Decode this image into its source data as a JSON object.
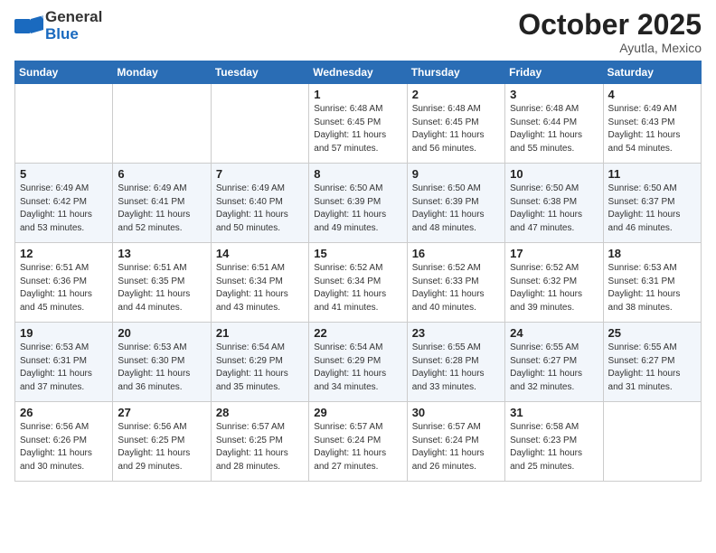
{
  "header": {
    "logo_general": "General",
    "logo_blue": "Blue",
    "month_title": "October 2025",
    "location": "Ayutla, Mexico"
  },
  "days_of_week": [
    "Sunday",
    "Monday",
    "Tuesday",
    "Wednesday",
    "Thursday",
    "Friday",
    "Saturday"
  ],
  "weeks": [
    [
      {
        "day": "",
        "info": ""
      },
      {
        "day": "",
        "info": ""
      },
      {
        "day": "",
        "info": ""
      },
      {
        "day": "1",
        "info": "Sunrise: 6:48 AM\nSunset: 6:45 PM\nDaylight: 11 hours\nand 57 minutes."
      },
      {
        "day": "2",
        "info": "Sunrise: 6:48 AM\nSunset: 6:45 PM\nDaylight: 11 hours\nand 56 minutes."
      },
      {
        "day": "3",
        "info": "Sunrise: 6:48 AM\nSunset: 6:44 PM\nDaylight: 11 hours\nand 55 minutes."
      },
      {
        "day": "4",
        "info": "Sunrise: 6:49 AM\nSunset: 6:43 PM\nDaylight: 11 hours\nand 54 minutes."
      }
    ],
    [
      {
        "day": "5",
        "info": "Sunrise: 6:49 AM\nSunset: 6:42 PM\nDaylight: 11 hours\nand 53 minutes."
      },
      {
        "day": "6",
        "info": "Sunrise: 6:49 AM\nSunset: 6:41 PM\nDaylight: 11 hours\nand 52 minutes."
      },
      {
        "day": "7",
        "info": "Sunrise: 6:49 AM\nSunset: 6:40 PM\nDaylight: 11 hours\nand 50 minutes."
      },
      {
        "day": "8",
        "info": "Sunrise: 6:50 AM\nSunset: 6:39 PM\nDaylight: 11 hours\nand 49 minutes."
      },
      {
        "day": "9",
        "info": "Sunrise: 6:50 AM\nSunset: 6:39 PM\nDaylight: 11 hours\nand 48 minutes."
      },
      {
        "day": "10",
        "info": "Sunrise: 6:50 AM\nSunset: 6:38 PM\nDaylight: 11 hours\nand 47 minutes."
      },
      {
        "day": "11",
        "info": "Sunrise: 6:50 AM\nSunset: 6:37 PM\nDaylight: 11 hours\nand 46 minutes."
      }
    ],
    [
      {
        "day": "12",
        "info": "Sunrise: 6:51 AM\nSunset: 6:36 PM\nDaylight: 11 hours\nand 45 minutes."
      },
      {
        "day": "13",
        "info": "Sunrise: 6:51 AM\nSunset: 6:35 PM\nDaylight: 11 hours\nand 44 minutes."
      },
      {
        "day": "14",
        "info": "Sunrise: 6:51 AM\nSunset: 6:34 PM\nDaylight: 11 hours\nand 43 minutes."
      },
      {
        "day": "15",
        "info": "Sunrise: 6:52 AM\nSunset: 6:34 PM\nDaylight: 11 hours\nand 41 minutes."
      },
      {
        "day": "16",
        "info": "Sunrise: 6:52 AM\nSunset: 6:33 PM\nDaylight: 11 hours\nand 40 minutes."
      },
      {
        "day": "17",
        "info": "Sunrise: 6:52 AM\nSunset: 6:32 PM\nDaylight: 11 hours\nand 39 minutes."
      },
      {
        "day": "18",
        "info": "Sunrise: 6:53 AM\nSunset: 6:31 PM\nDaylight: 11 hours\nand 38 minutes."
      }
    ],
    [
      {
        "day": "19",
        "info": "Sunrise: 6:53 AM\nSunset: 6:31 PM\nDaylight: 11 hours\nand 37 minutes."
      },
      {
        "day": "20",
        "info": "Sunrise: 6:53 AM\nSunset: 6:30 PM\nDaylight: 11 hours\nand 36 minutes."
      },
      {
        "day": "21",
        "info": "Sunrise: 6:54 AM\nSunset: 6:29 PM\nDaylight: 11 hours\nand 35 minutes."
      },
      {
        "day": "22",
        "info": "Sunrise: 6:54 AM\nSunset: 6:29 PM\nDaylight: 11 hours\nand 34 minutes."
      },
      {
        "day": "23",
        "info": "Sunrise: 6:55 AM\nSunset: 6:28 PM\nDaylight: 11 hours\nand 33 minutes."
      },
      {
        "day": "24",
        "info": "Sunrise: 6:55 AM\nSunset: 6:27 PM\nDaylight: 11 hours\nand 32 minutes."
      },
      {
        "day": "25",
        "info": "Sunrise: 6:55 AM\nSunset: 6:27 PM\nDaylight: 11 hours\nand 31 minutes."
      }
    ],
    [
      {
        "day": "26",
        "info": "Sunrise: 6:56 AM\nSunset: 6:26 PM\nDaylight: 11 hours\nand 30 minutes."
      },
      {
        "day": "27",
        "info": "Sunrise: 6:56 AM\nSunset: 6:25 PM\nDaylight: 11 hours\nand 29 minutes."
      },
      {
        "day": "28",
        "info": "Sunrise: 6:57 AM\nSunset: 6:25 PM\nDaylight: 11 hours\nand 28 minutes."
      },
      {
        "day": "29",
        "info": "Sunrise: 6:57 AM\nSunset: 6:24 PM\nDaylight: 11 hours\nand 27 minutes."
      },
      {
        "day": "30",
        "info": "Sunrise: 6:57 AM\nSunset: 6:24 PM\nDaylight: 11 hours\nand 26 minutes."
      },
      {
        "day": "31",
        "info": "Sunrise: 6:58 AM\nSunset: 6:23 PM\nDaylight: 11 hours\nand 25 minutes."
      },
      {
        "day": "",
        "info": ""
      }
    ]
  ]
}
